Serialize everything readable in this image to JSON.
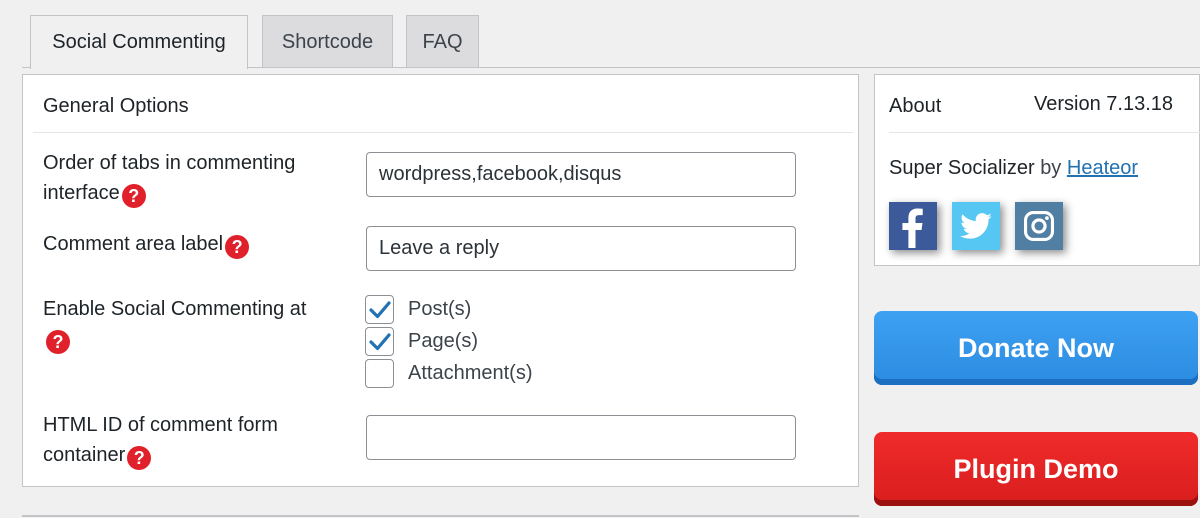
{
  "tabs": [
    {
      "label": "Social Commenting",
      "active": true
    },
    {
      "label": "Shortcode",
      "active": false
    },
    {
      "label": "FAQ",
      "active": false
    }
  ],
  "general": {
    "title": "General Options",
    "order_label_line1": "Order of tabs in commenting",
    "order_label_line2": "interface",
    "order_value": "wordpress,facebook,disqus",
    "comment_area_label": "Comment area label",
    "comment_area_value": "Leave a reply",
    "enable_label": "Enable Social Commenting at",
    "checkboxes": [
      {
        "label": "Post(s)",
        "checked": true
      },
      {
        "label": "Page(s)",
        "checked": true
      },
      {
        "label": "Attachment(s)",
        "checked": false
      }
    ],
    "html_id_label_line1": "HTML ID of comment form",
    "html_id_label_line2": "container",
    "html_id_value": "",
    "help_glyph": "?"
  },
  "about": {
    "title": "About",
    "version": "Version 7.13.18",
    "plugin_name": "Super Socializer",
    "by": "by",
    "author": "Heateor",
    "icons": [
      "facebook-icon",
      "twitter-icon",
      "instagram-icon"
    ]
  },
  "buttons": {
    "donate": "Donate Now",
    "demo": "Plugin Demo"
  },
  "colors": {
    "facebook": "#3c5a99",
    "twitter": "#55c7f2",
    "instagram": "#517fa4",
    "help": "#e0202a",
    "donate": "#2a8be0",
    "demo": "#e02020"
  }
}
